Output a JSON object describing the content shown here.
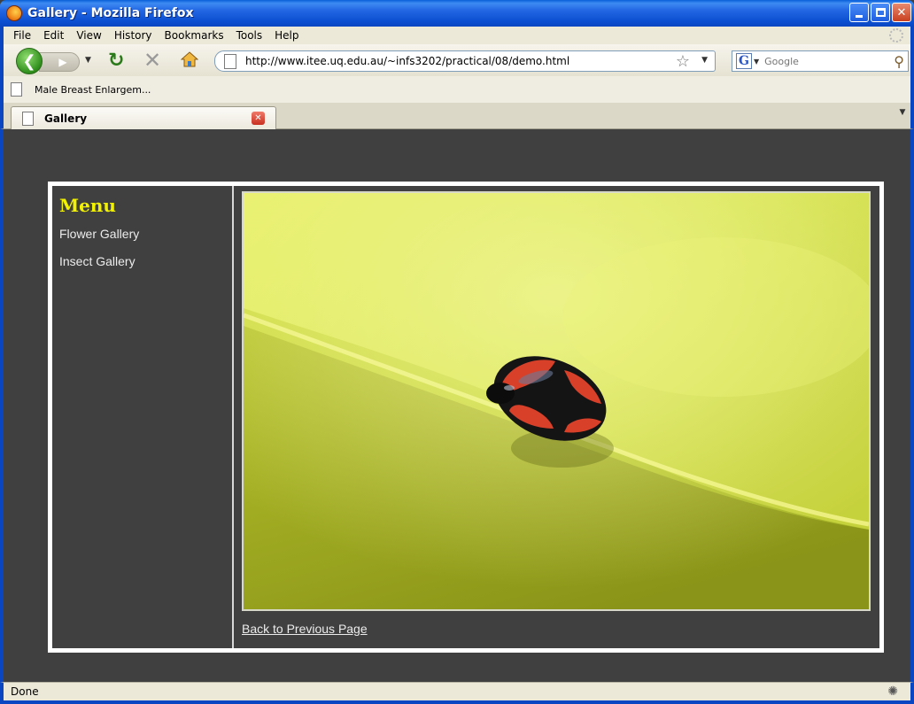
{
  "window": {
    "title": "Gallery - Mozilla Firefox"
  },
  "menubar": {
    "items": [
      {
        "label": "File"
      },
      {
        "label": "Edit"
      },
      {
        "label": "View"
      },
      {
        "label": "History"
      },
      {
        "label": "Bookmarks"
      },
      {
        "label": "Tools"
      },
      {
        "label": "Help"
      }
    ]
  },
  "navbar": {
    "url": "http://www.itee.uq.edu.au/~infs3202/practical/08/demo.html",
    "search_placeholder": "Google"
  },
  "bookmarks": {
    "items": [
      {
        "label": "Male Breast Enlargem..."
      }
    ]
  },
  "tabs": [
    {
      "label": "Gallery",
      "active": true
    }
  ],
  "page": {
    "menu_heading": "Menu",
    "links": [
      {
        "label": "Flower Gallery"
      },
      {
        "label": "Insect Gallery"
      }
    ],
    "back_link": "Back to Previous Page"
  },
  "status": {
    "text": "Done"
  },
  "colors": {
    "page_background": "#404040",
    "menu_heading": "#f2f200",
    "frame_border": "#ffffff",
    "titlebar": "#0b4fd1"
  },
  "icons": {
    "app": "firefox-icon",
    "back": "back-arrow-icon",
    "forward": "forward-arrow-icon",
    "reload": "reload-icon",
    "stop": "stop-icon",
    "home": "home-icon",
    "bookmark_star": "star-icon",
    "search_engine": "google-icon",
    "search": "magnifier-icon",
    "tab_close": "close-icon",
    "status_addon": "bug-icon"
  }
}
